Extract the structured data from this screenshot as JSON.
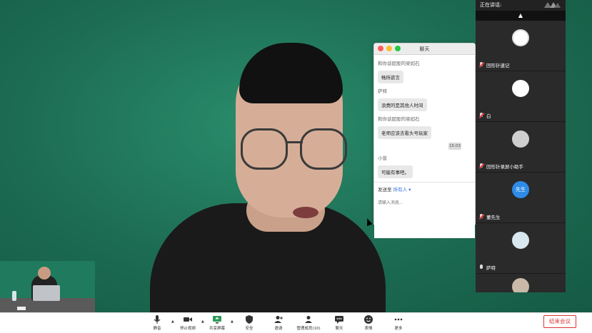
{
  "chat": {
    "title": "聊天",
    "messages": [
      {
        "sender": "和你谈屁股的梁如石",
        "text": "畅所欲言"
      },
      {
        "sender": "萨特",
        "text": "浪费的是其他人时间"
      },
      {
        "sender": "和你谈屁股的梁如石",
        "text": "老师应该去看头号玩家"
      }
    ],
    "timestamp": "15:03",
    "messages_after": [
      {
        "sender": "小曾",
        "text": "可能有事吧。"
      }
    ],
    "send_to_label": "发送至",
    "send_to_target": "所有人",
    "input_placeholder": "请输入消息..."
  },
  "participants_panel": {
    "speaking_label": "正在讲话:",
    "tiles": [
      {
        "name": "回形针速记",
        "avatar": "logo",
        "mic": "off"
      },
      {
        "name": "白",
        "avatar": "white-circle",
        "mic": "off"
      },
      {
        "name": "回形针录屏小助手",
        "avatar": "gray-person",
        "mic": "off"
      },
      {
        "name": "董先生",
        "avatar": "text",
        "avatar_text": "先生",
        "mic": "off"
      },
      {
        "name": "萨特",
        "avatar": "robot",
        "mic": "on"
      }
    ]
  },
  "toolbar": {
    "mute_label": "静音",
    "stop_video_label": "停止视频",
    "share_screen_label": "共享屏幕",
    "security_label": "安全",
    "invite_label": "邀请",
    "manage_members_label": "管理成员(10)",
    "chat_label": "聊天",
    "reactions_label": "表情",
    "more_label": "更多",
    "end_meeting_label": "结束会议"
  },
  "colors": {
    "end_meeting": "#d33333",
    "accent_blue": "#2e8be6",
    "video_bg": "#1c6b52"
  }
}
